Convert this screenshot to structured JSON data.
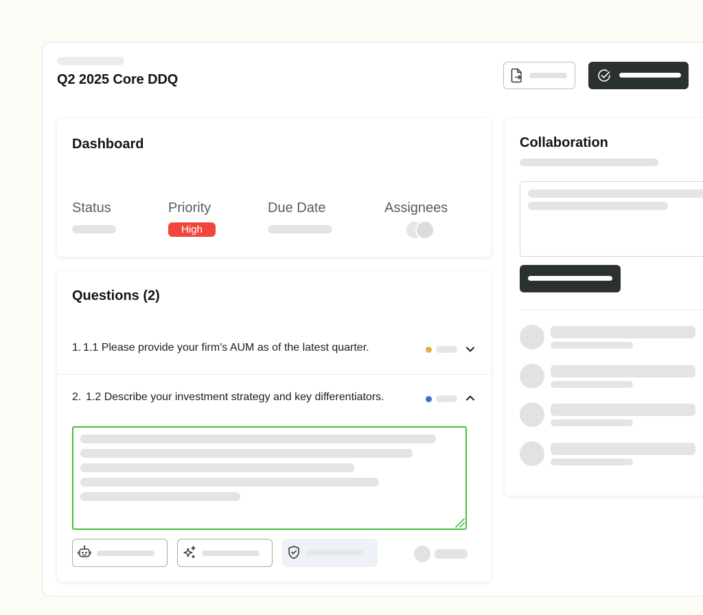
{
  "header": {
    "title": "Q2 2025 Core DDQ"
  },
  "dashboard": {
    "title": "Dashboard",
    "status_label": "Status",
    "priority_label": "Priority",
    "priority_value": "High",
    "due_date_label": "Due Date",
    "assignees_label": "Assignees"
  },
  "questions": {
    "title": "Questions (2)",
    "items": [
      {
        "number": "1.",
        "text": "1.1 Please provide your firm's AUM as of the latest quarter.",
        "status_color": "#e0b43a",
        "expanded": false
      },
      {
        "number": "2.",
        "text": "1.2 Describe your investment strategy and key differentiators.",
        "status_color": "#3a6fd8",
        "expanded": true
      }
    ],
    "chevron_down": "⌄",
    "chevron_up": "⌃"
  },
  "collaboration": {
    "title": "Collaboration"
  },
  "colors": {
    "dark_button": "#2b3131",
    "priority_high": "#f1463d",
    "answer_border": "#3fbf3a"
  }
}
